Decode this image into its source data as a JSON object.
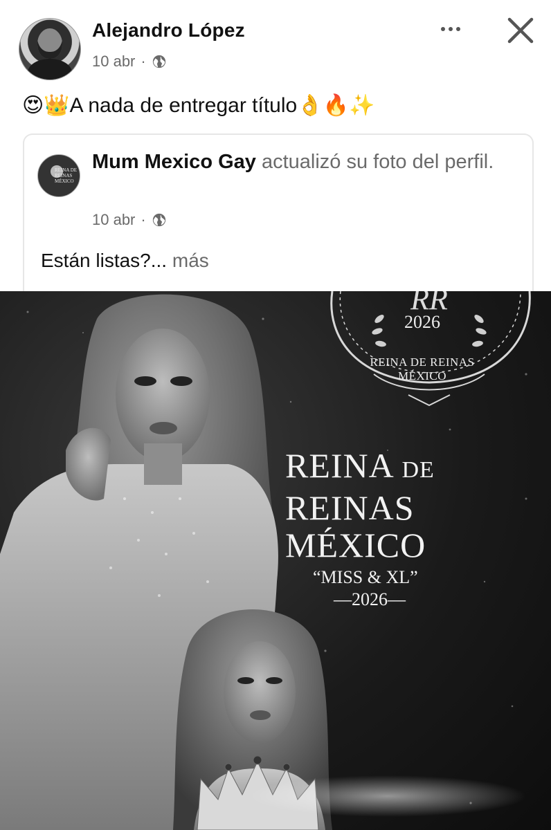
{
  "post": {
    "author": "Alejandro López",
    "date": "10 abr",
    "separator": "·",
    "audience_icon": "globe-icon",
    "text_emoji_prefix": "😍👑",
    "text": "A nada de entregar título",
    "text_emoji_suffix": "👌🔥✨"
  },
  "shared": {
    "page_name": "Mum Mexico Gay",
    "action": "actualizó su foto del perfil.",
    "date": "10 abr",
    "separator": "·",
    "text": "Están listas?...",
    "more_label": "más",
    "avatar_text": "REINA DE REINAS MÉXICO"
  },
  "poster": {
    "emblem_monogram": "RR",
    "emblem_year": "2026",
    "emblem_line1": "REINA DE REINAS",
    "emblem_line2": "MÉXICO",
    "title_word1": "REINA",
    "title_word2": "DE",
    "title_line2": "REINAS",
    "title_line3": "MÉXICO",
    "subtitle": "“MISS & XL”",
    "year": "—2026—"
  },
  "icons": {
    "more": "more-horizontal-icon",
    "close": "close-icon"
  },
  "colors": {
    "name": "#111111",
    "meta": "#6a6a6a",
    "card_border": "#e6e6e6",
    "photo_bg": "#1a1a1a"
  }
}
